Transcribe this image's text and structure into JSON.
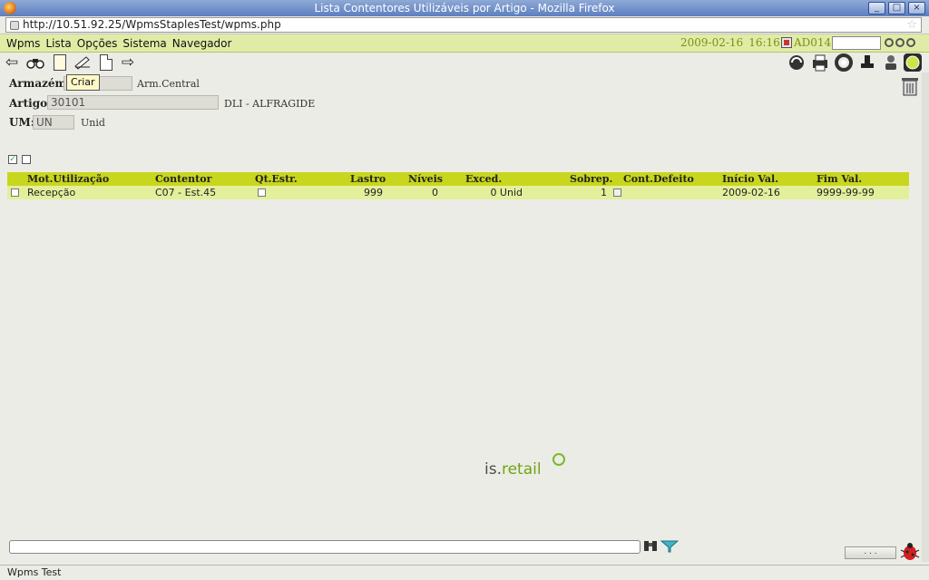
{
  "window": {
    "title": "Lista Contentores Utilizáveis por Artigo - Mozilla Firefox",
    "buttons": [
      "_",
      "□",
      "×"
    ]
  },
  "browser": {
    "url": "http://10.51.92.25/WpmsStaplesTest/wpms.php",
    "status": "Wpms Test"
  },
  "menu": {
    "items": [
      "Wpms",
      "Lista",
      "Opções",
      "Sistema",
      "Navegador"
    ],
    "date": "2009-02-16",
    "time": "16:16",
    "user": "AD014"
  },
  "tooltip": "Criar",
  "form": {
    "armazem_label": "Armazém:",
    "armazem_value": "",
    "armazem_desc": "Arm.Central",
    "artigo_label": "Artigo:",
    "artigo_value": "30101",
    "artigo_desc": "DLI - ALFRAGIDE",
    "um_label": "UM:",
    "um_value": "UN",
    "um_desc": "Unid"
  },
  "grid": {
    "columns": [
      "Mot.Utilização",
      "Contentor",
      "Qt.Estr.",
      "Lastro",
      "Níveis",
      "Exced.",
      "Sobrep.",
      "Cont.Defeito",
      "Início Val.",
      "Fim Val."
    ],
    "rows": [
      {
        "mot": "Recepção",
        "contentor": "C07 - Est.45",
        "lastro": "999",
        "niveis": "0",
        "exced": "0 Unid",
        "sobrep": "1",
        "inicio": "2009-02-16",
        "fim": "9999-99-99"
      }
    ]
  },
  "logo": {
    "part1": "is.",
    "part2": "retail"
  },
  "footer": {
    "more_label": ". . ."
  },
  "colors": {
    "header": "#c8d61e",
    "row": "#e4ef9c",
    "menubar": "#e0eca6",
    "accent_text": "#7d8f14"
  }
}
